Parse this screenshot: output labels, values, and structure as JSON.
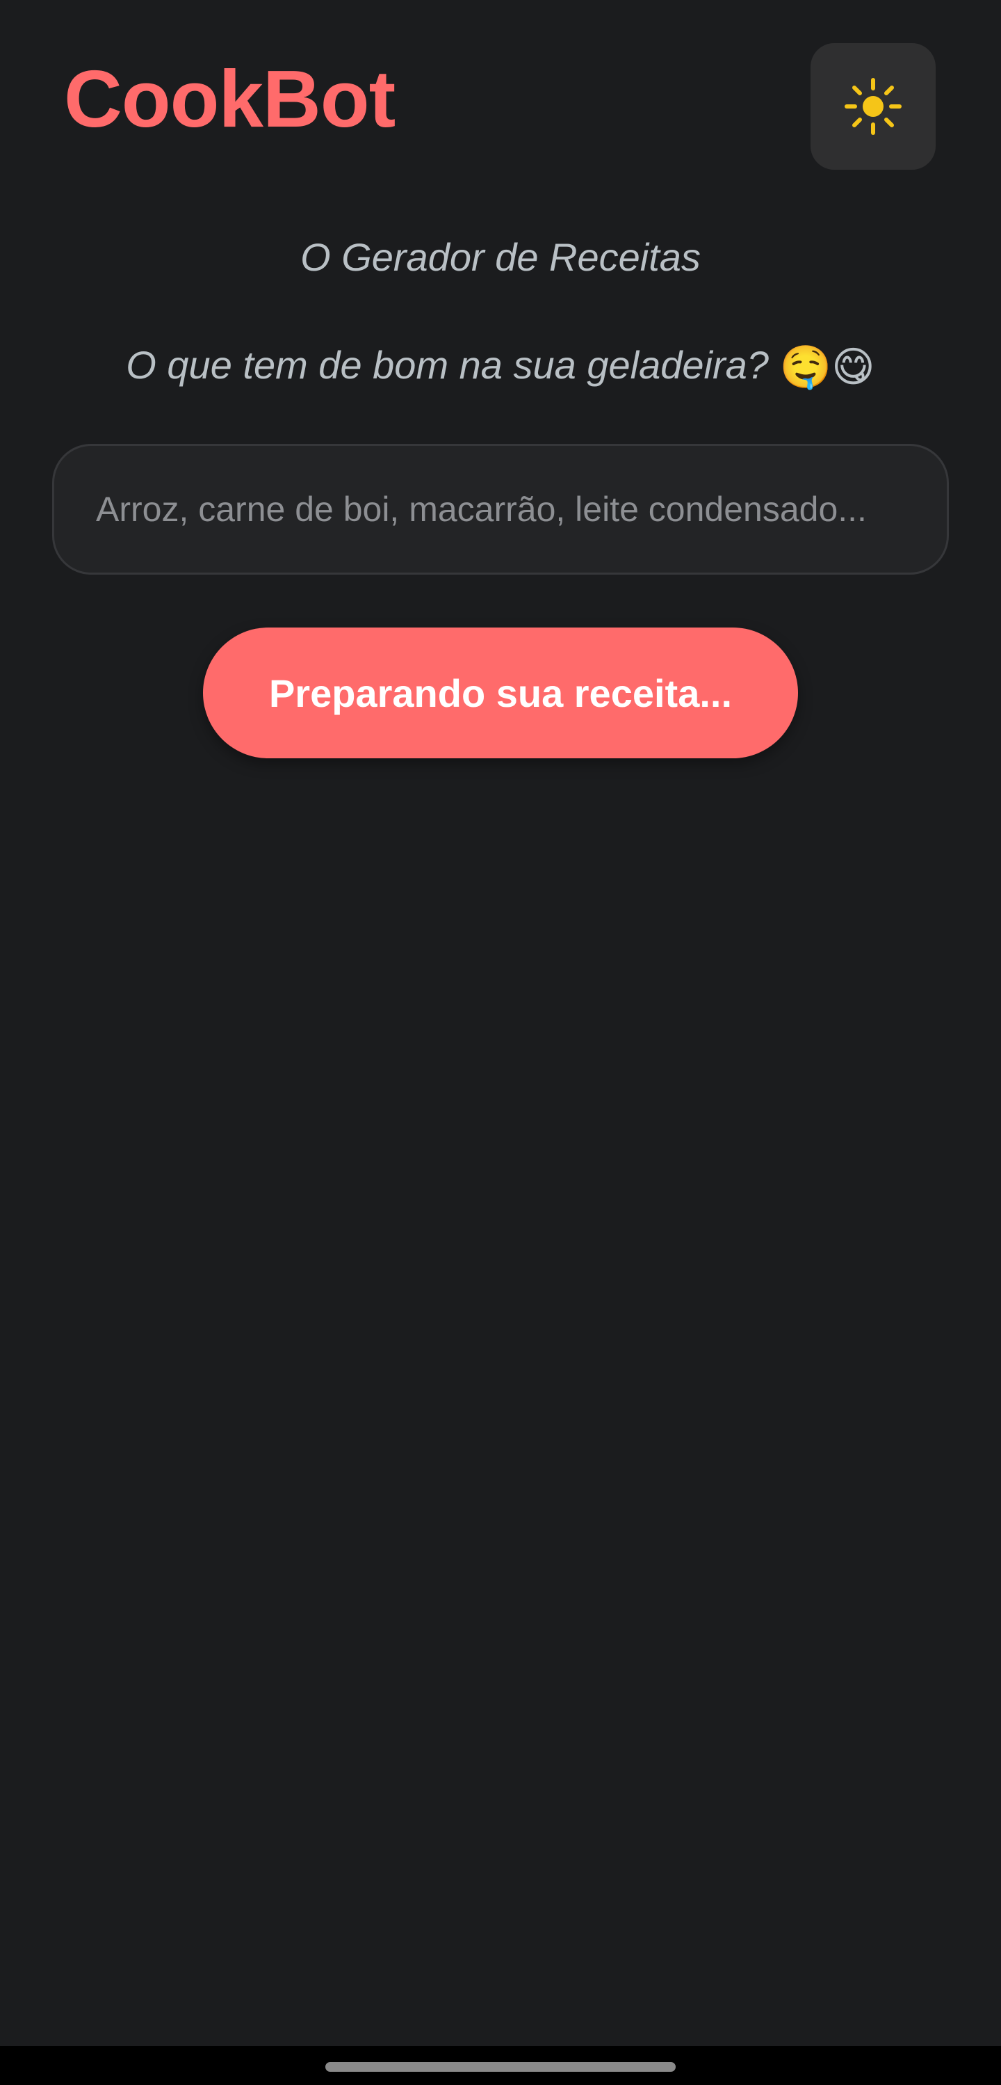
{
  "app": {
    "title": "CookBot"
  },
  "theme_toggle": {
    "icon": "sun-icon",
    "icon_color": "#f5c518"
  },
  "subtitles": {
    "tagline": "O Gerador de Receitas",
    "prompt": "O que tem de bom na sua geladeira?",
    "prompt_emojis": "🤤😋"
  },
  "ingredients_input": {
    "value": "",
    "placeholder": "Arroz, carne de boi, macarrão, leite condensado..."
  },
  "generate_button": {
    "label": "Preparando sua receita..."
  },
  "colors": {
    "background": "#1b1c1e",
    "accent": "#ff6b6b",
    "text_muted": "#b9c0c5"
  }
}
